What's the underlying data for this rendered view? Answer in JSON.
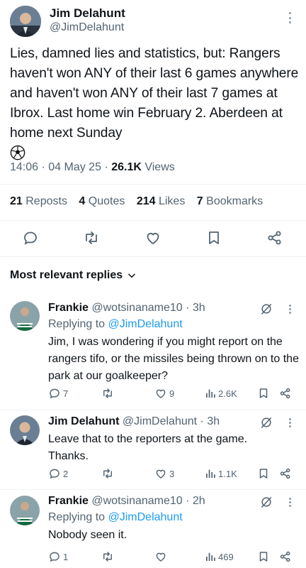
{
  "main_tweet": {
    "author_name": "Jim Delahunt",
    "author_handle": "@JimDelahunt",
    "text": "Lies, damned lies and statistics, but: Rangers haven't won ANY of their last 6 games anywhere and haven't won ANY of their last 7 games at Ibrox. Last home win February 2. Aberdeen at home next Sunday",
    "emoji_icon": "soccer-ball-icon",
    "time": "14:06",
    "date": "04 May 25",
    "views_count": "26.1K",
    "views_label": "Views",
    "reposts_count": "21",
    "reposts_label": "Reposts",
    "quotes_count": "4",
    "quotes_label": "Quotes",
    "likes_count": "214",
    "likes_label": "Likes",
    "bookmarks_count": "7",
    "bookmarks_label": "Bookmarks"
  },
  "replies_header": {
    "sort_label": "Most relevant replies"
  },
  "replies": [
    {
      "author_name": "Frankie",
      "author_handle": "@wotsinaname10",
      "time": "3h",
      "replying_prefix": "Replying to",
      "replying_to": "@JimDelahunt",
      "text": "Jim, I was wondering if you might report on the rangers tifo, or the missiles being thrown on to the park at our goalkeeper?",
      "replies_count": "7",
      "reposts_count": "",
      "likes_count": "9",
      "views_count": "2.6K"
    },
    {
      "author_name": "Jim Delahunt",
      "author_handle": "@JimDelahunt",
      "time": "3h",
      "text": "Leave that to the reporters at the game. Thanks.",
      "replies_count": "2",
      "reposts_count": "",
      "likes_count": "3",
      "views_count": "1.1K"
    },
    {
      "author_name": "Frankie",
      "author_handle": "@wotsinaname10",
      "time": "2h",
      "replying_prefix": "Replying to",
      "replying_to": "@JimDelahunt",
      "text": "Nobody seen it.",
      "replies_count": "1",
      "reposts_count": "",
      "likes_count": "",
      "views_count": "469"
    }
  ],
  "colors": {
    "accent": "#1d9bf0",
    "text": "#0f1419",
    "muted": "#536471",
    "divider": "#eff3f4"
  }
}
